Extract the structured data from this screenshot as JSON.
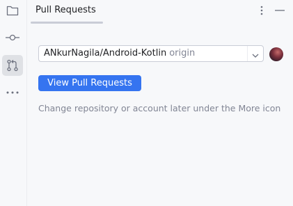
{
  "tool_window": {
    "title": "Pull Requests",
    "more_icon": "more-vertical-icon",
    "minimize_icon": "minimize-icon"
  },
  "activity_bar": {
    "items": [
      {
        "name": "project",
        "icon": "folder-icon"
      },
      {
        "name": "commit",
        "icon": "commit-icon"
      },
      {
        "name": "pull-requests",
        "icon": "pull-request-icon",
        "active": true
      },
      {
        "name": "more-tools",
        "icon": "more-horizontal-icon"
      }
    ]
  },
  "repository": {
    "name": "ANkurNagila/Android-Kotlin",
    "remote": "origin",
    "dropdown_icon": "chevron-down-icon"
  },
  "account": {
    "avatar": "user-avatar"
  },
  "actions": {
    "view_pull_requests": "View Pull Requests"
  },
  "hint": "Change repository or account later under the More icon",
  "colors": {
    "primary_button": "#3574f0",
    "active_tool_bg": "#dfe1e5",
    "hint_text": "#818594"
  }
}
